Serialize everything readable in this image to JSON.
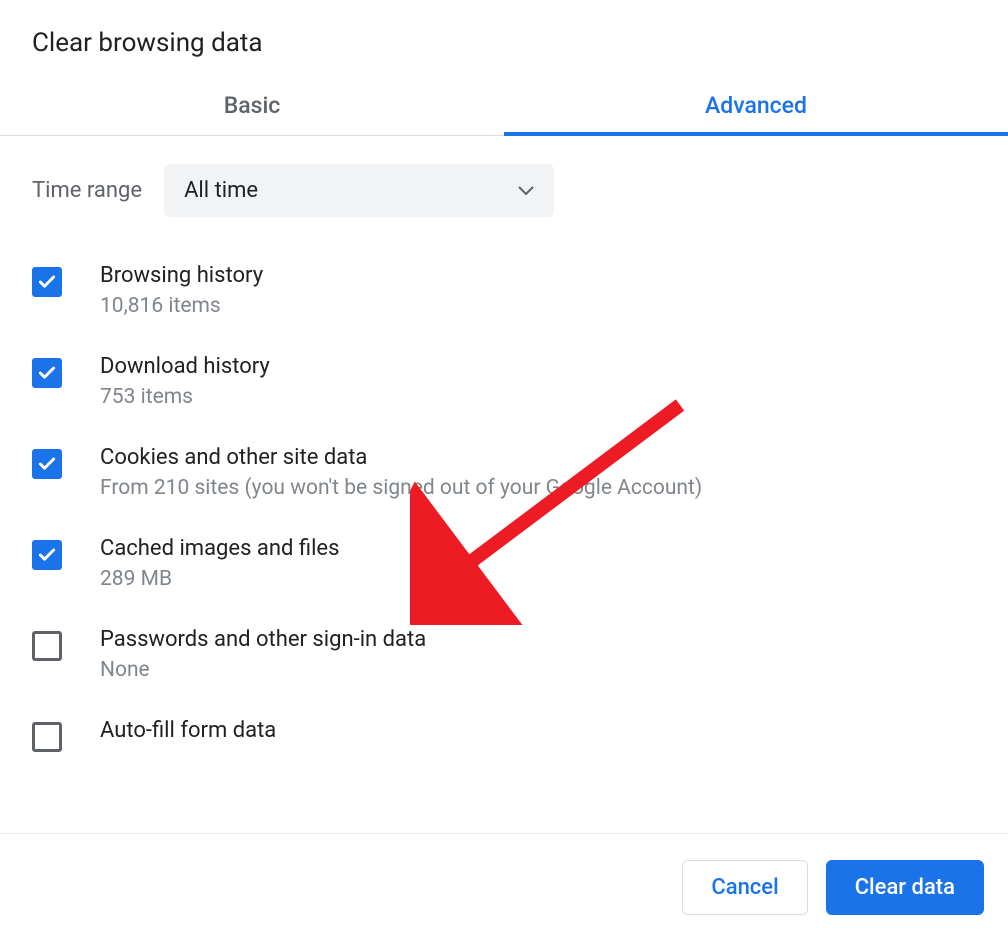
{
  "title": "Clear browsing data",
  "tabs": {
    "basic": "Basic",
    "advanced": "Advanced"
  },
  "time_range": {
    "label": "Time range",
    "value": "All time"
  },
  "options": [
    {
      "title": "Browsing history",
      "sub": "10,816 items",
      "checked": true
    },
    {
      "title": "Download history",
      "sub": "753 items",
      "checked": true
    },
    {
      "title": "Cookies and other site data",
      "sub": "From 210 sites (you won't be signed out of your Google Account)",
      "checked": true
    },
    {
      "title": "Cached images and files",
      "sub": "289 MB",
      "checked": true
    },
    {
      "title": "Passwords and other sign-in data",
      "sub": "None",
      "checked": false
    },
    {
      "title": "Auto-fill form data",
      "sub": "",
      "checked": false
    }
  ],
  "buttons": {
    "cancel": "Cancel",
    "clear": "Clear data"
  }
}
